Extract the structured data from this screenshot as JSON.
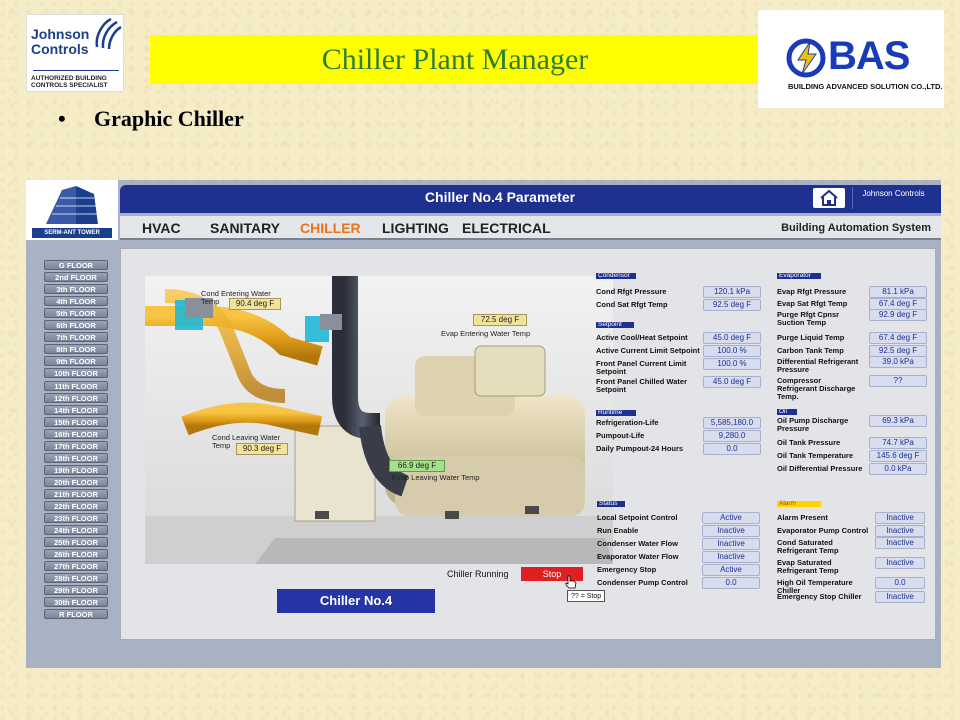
{
  "slide": {
    "title": "Chiller Plant Manager",
    "bullet": "•",
    "bullet_text": "Graphic Chiller"
  },
  "logos": {
    "jc_name": "Johnson Controls",
    "jc_tag": "AUTHORIZED BUILDING CONTROLS SPECIALIST",
    "bas_name": "BAS",
    "bas_sub": "BUILDING ADVANCED SOLUTION CO.,LTD."
  },
  "app": {
    "title": "Chiller No.4 Parameter",
    "building": "SERM-ANT TOWER",
    "jc_small": "Johnson Controls",
    "nav": [
      "HVAC",
      "SANITARY",
      "CHILLER",
      "LIGHTING",
      "ELECTRICAL"
    ],
    "nav_active": "CHILLER",
    "nav_right": "Building Automation System",
    "floors": [
      "G FLOOR",
      "2nd FLOOR",
      "3th FLOOR",
      "4th FLOOR",
      "5th FLOOR",
      "6th FLOOR",
      "7th FLOOR",
      "8th FLOOR",
      "9th FLOOR",
      "10th FLOOR",
      "11th FLOOR",
      "12th FLOOR",
      "14th FLOOR",
      "15th FLOOR",
      "16th FLOOR",
      "17th FLOOR",
      "18th FLOOR",
      "19th FLOOR",
      "20th FLOOR",
      "21th FLOOR",
      "22th FLOOR",
      "23th FLOOR",
      "24th FLOOR",
      "25th FLOOR",
      "26th FLOOR",
      "27th FLOOR",
      "28th FLOOR",
      "29th FLOOR",
      "30th FLOOR",
      "R FLOOR"
    ]
  },
  "scene": {
    "cond_entering_label": "Cond Entering Water Temp",
    "cond_entering_value": "90.4 deg F",
    "cond_leaving_label": "Cond Leaving Water Temp",
    "cond_leaving_value": "90.3 deg F",
    "evap_entering_label": "Evap Entering Water Temp",
    "evap_entering_value": "72.5 deg F",
    "evap_leaving_label": "Evap Leaving Water Temp",
    "evap_leaving_value": "66.9 deg F",
    "status_label": "Chiller Running",
    "stop_label": "Stop",
    "tooltip": "?? = Stop",
    "chiller_name": "Chiller No.4"
  },
  "condensor": {
    "title": "Condensor",
    "rows": [
      {
        "label": "Cond Rfgt Pressure",
        "value": "120.1 kPa"
      },
      {
        "label": "Cond Sat Rfgt Temp",
        "value": "92.5 deg F"
      }
    ]
  },
  "setpoint": {
    "title": "Setpoint",
    "rows": [
      {
        "label": "Active Cool/Heat Setpoint",
        "value": "45.0 deg F"
      },
      {
        "label": "Active Current Limit Setpoint",
        "value": "100.0 %"
      },
      {
        "label": "Front Panel Current Limit Setpoint",
        "value": "100.0 %"
      },
      {
        "label": "Front Panel Chilled Water Setpoint",
        "value": "45.0 deg F"
      }
    ]
  },
  "runtime": {
    "title": "Runtime",
    "rows": [
      {
        "label": "Refrigeration-Life",
        "value": "5,585,180.0"
      },
      {
        "label": "Pumpout-Life",
        "value": "9,280.0"
      },
      {
        "label": "Daily Pumpout-24 Hours",
        "value": "0.0"
      }
    ]
  },
  "evaporator": {
    "title": "Evaporator",
    "rows": [
      {
        "label": "Evap Rfgt Pressure",
        "value": "81.1 kPa"
      },
      {
        "label": "Evap Sat Rfgt Temp",
        "value": "67.4 deg F"
      },
      {
        "label": "Purge Rfgt Cpnsr Suction Temp",
        "value": "92.9 deg F"
      },
      {
        "label": "Purge Liquid Temp",
        "value": "67.4 deg F"
      },
      {
        "label": "Carbon Tank Temp",
        "value": "92.5 deg F"
      },
      {
        "label": "Differential Refrigerant Pressure",
        "value": "39.0 kPa"
      },
      {
        "label": "Compressor Refrigerant Discharge Temp.",
        "value": "??"
      }
    ]
  },
  "oil": {
    "title": "Oil",
    "rows": [
      {
        "label": "Oil Pump Discharge Pressure",
        "value": "69.3 kPa"
      },
      {
        "label": "Oil Tank Pressure",
        "value": "74.7 kPa"
      },
      {
        "label": "Oil Tank Temperature",
        "value": "145.6 deg F"
      },
      {
        "label": "Oil Differential Pressure",
        "value": "0.0 kPa"
      }
    ]
  },
  "status": {
    "title": "Status",
    "rows": [
      {
        "label": "Local Setpoint Control",
        "value": "Active"
      },
      {
        "label": "Run Enable",
        "value": "Inactive"
      },
      {
        "label": "Condenser Water Flow",
        "value": "Inactive"
      },
      {
        "label": "Evaporator Water Flow",
        "value": "Inactive"
      },
      {
        "label": "Emergency Stop",
        "value": "Active"
      },
      {
        "label": "Condenser Pump Control",
        "value": "0.0"
      }
    ]
  },
  "alarm": {
    "title": "Alarm",
    "rows": [
      {
        "label": "Alarm Present",
        "value": "Inactive"
      },
      {
        "label": "Evaporator Pump Control",
        "value": "Inactive"
      },
      {
        "label": "Cond Saturated Refrigerant Temp",
        "value": "Inactive"
      },
      {
        "label": "Evap Saturated Refrigerant Temp",
        "value": "Inactive"
      },
      {
        "label": "High Oil Temperature Chiller",
        "value": "0.0"
      },
      {
        "label": "Emergency Stop Chiller",
        "value": "Inactive"
      }
    ]
  },
  "colors": {
    "nav_active": "#e8741c",
    "header": "#1f3190",
    "title_bg": "#ffff00",
    "title_text": "#2e7d32",
    "alarm_title": "#ffd200",
    "stop": "#e02020"
  }
}
